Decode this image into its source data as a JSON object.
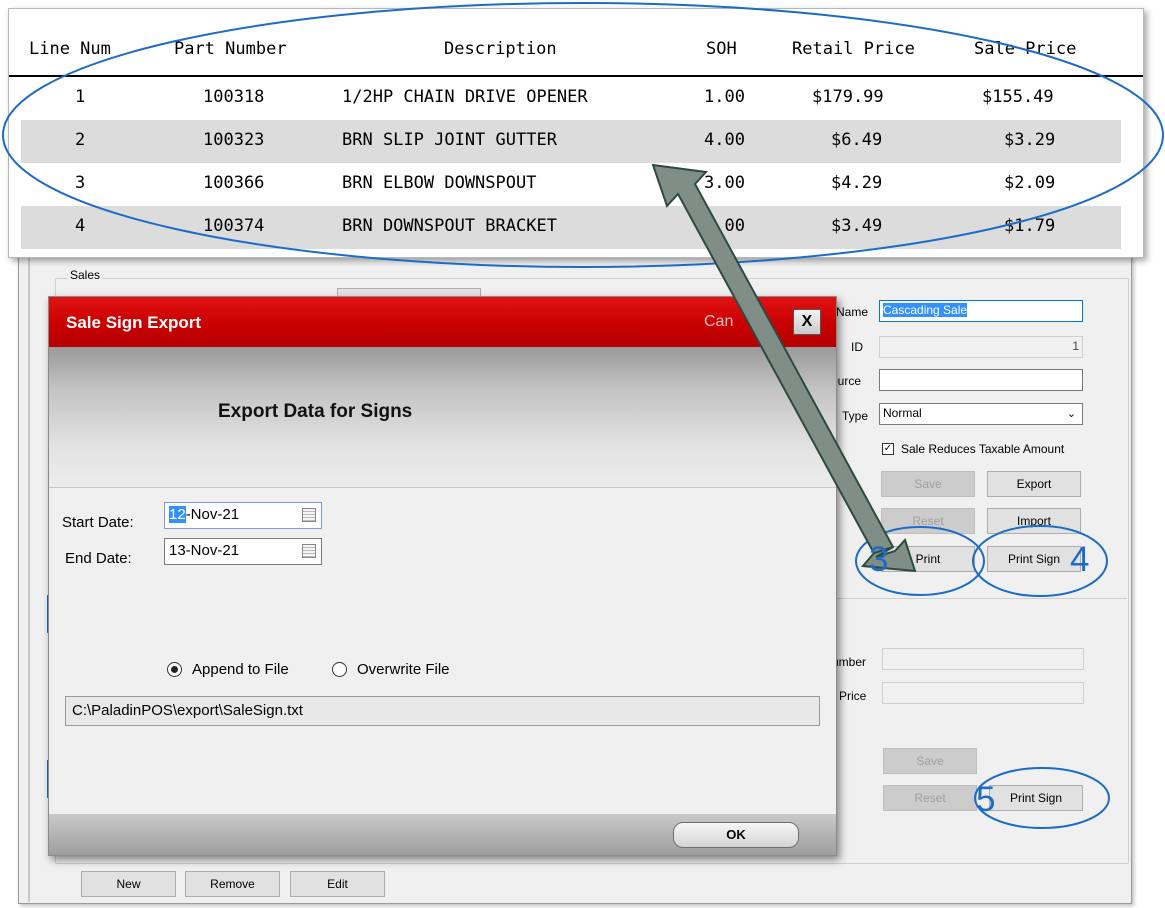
{
  "zoom_table": {
    "headers": [
      "Line Num",
      "Part Number",
      "Description",
      "SOH",
      "Retail Price",
      "Sale Price"
    ],
    "rows": [
      [
        "1",
        "100318",
        "1/2HP CHAIN DRIVE OPENER",
        "1.00",
        "$179.99",
        "$155.49"
      ],
      [
        "2",
        "100323",
        "BRN SLIP JOINT GUTTER",
        "4.00",
        "$6.49",
        "$3.29"
      ],
      [
        "3",
        "100366",
        "BRN ELBOW DOWNSPOUT",
        "3.00",
        "$4.29",
        "$2.09"
      ],
      [
        "4",
        "100374",
        "BRN DOWNSPOUT BRACKET",
        "6.00",
        "$3.49",
        "$1.79"
      ]
    ]
  },
  "background": {
    "sales_group_label": "Sales",
    "form": {
      "name_label": "Name",
      "name_value": "Cascading Sale",
      "id_label": "ID",
      "id_value": "1",
      "source_label": "ource",
      "source_value": "",
      "type_label": "Type",
      "type_value": "Normal",
      "reduces_tax_label": "Sale Reduces Taxable Amount",
      "reduces_tax_checked": true
    },
    "buttons": {
      "save": "Save",
      "export": "Export",
      "reset": "Reset",
      "import": "Import",
      "print": "Print",
      "print_sign": "Print Sign"
    },
    "item_form": {
      "number_label": "umber",
      "price_label": "Price",
      "save": "Save",
      "reset": "Reset",
      "print_sign": "Print Sign"
    },
    "bottom_buttons": {
      "new": "New",
      "remove": "Remove",
      "edit": "Edit"
    }
  },
  "dialog": {
    "title": "Sale Sign Export",
    "cancel_text": "Can",
    "close_glyph": "X",
    "header": "Export Data for Signs",
    "start_date_label": "Start Date:",
    "start_date_highlight": "12",
    "start_date_rest": "-Nov-21",
    "end_date_label": "End Date:",
    "end_date_value": "13-Nov-21",
    "append_label": "Append to File",
    "overwrite_label": "Overwrite File",
    "append_selected": true,
    "path_value": "C:\\PaladinPOS\\export\\SaleSign.txt",
    "ok_label": "OK"
  },
  "annotations": {
    "num3": "3",
    "num4": "4",
    "num5": "5",
    "ellipse_color": "#1e6bc7",
    "arrow_color": "#7f8f87"
  }
}
